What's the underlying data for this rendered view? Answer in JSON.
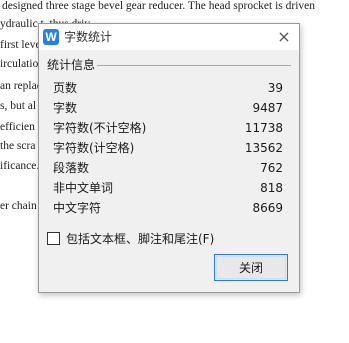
{
  "document": {
    "lines": [
      "designed three stage bevel gear reducer. The head sprocket is driven",
      "ydraulic                                                         t, thus driv",
      "first leve                                                      ement is re",
      "irculatio                                                       he leader p",
      "an replac                                                       only guaran",
      "s, but al                                                       a compariso",
      "efficien                                                        e further r",
      " the scra                                                       f the coal i",
      "ificance.",
      "",
      "er chain"
    ]
  },
  "dialog": {
    "title": "字数统计",
    "app_icon_glyph": "W",
    "app_icon_color": "#2b7de9",
    "close_glyph": "×",
    "group_title": "统计信息",
    "stats": [
      {
        "label": "页数",
        "value": "39"
      },
      {
        "label": "字数",
        "value": "9487"
      },
      {
        "label": "字符数(不计空格)",
        "value": "11738"
      },
      {
        "label": "字符数(计空格)",
        "value": "13562"
      },
      {
        "label": "段落数",
        "value": "762"
      },
      {
        "label": "非中文单词",
        "value": "818"
      },
      {
        "label": "中文字符",
        "value": "8669"
      }
    ],
    "checkbox_label": "包括文本框、脚注和尾注(F)",
    "checkbox_checked": false,
    "close_button_label": "关闭"
  }
}
